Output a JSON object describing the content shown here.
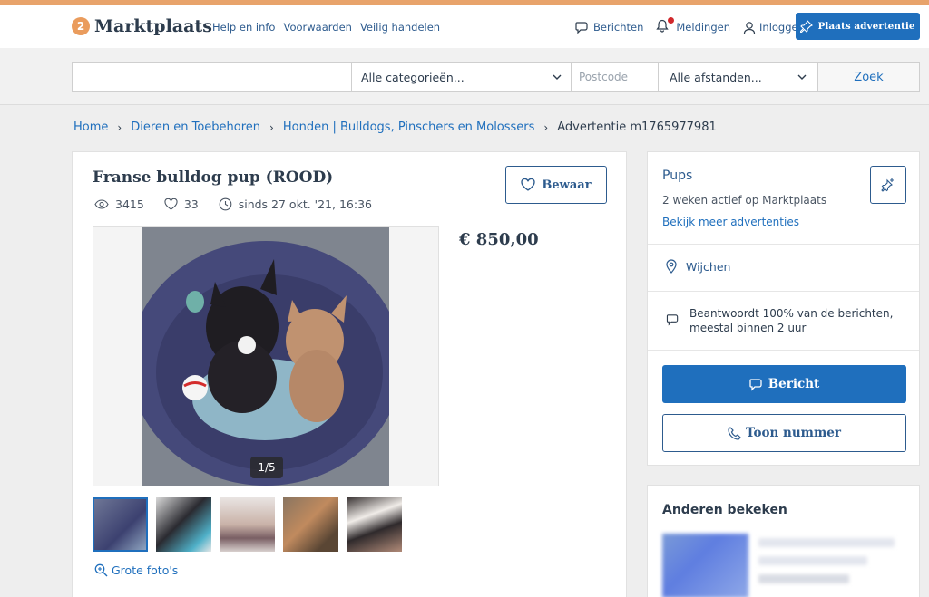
{
  "header": {
    "logo_badge": "2",
    "logo_text": "Marktplaats",
    "links": [
      "Help en info",
      "Voorwaarden",
      "Veilig handelen"
    ],
    "messages": "Berichten",
    "notifications": "Meldingen",
    "login": "Inloggen",
    "place_ad": "Plaats advertentie"
  },
  "search": {
    "query": "",
    "category": "Alle categorieën...",
    "postcode_placeholder": "Postcode",
    "distance": "Alle afstanden...",
    "button": "Zoek"
  },
  "breadcrumb": [
    "Home",
    "Dieren en Toebehoren",
    "Honden | Bulldogs, Pinschers en Molossers",
    "Advertentie m1765977981"
  ],
  "listing": {
    "title": "Franse bulldog pup (ROOD)",
    "views": "3415",
    "favorites": "33",
    "since": "sinds 27 okt. '21, 16:36",
    "save": "Bewaar",
    "price": "€ 850,00",
    "photo_counter": "1/5",
    "photo_count": 5,
    "large_photos": "Grote foto's"
  },
  "seller": {
    "name": "Pups",
    "active": "2 weken actief op Marktplaats",
    "more_ads": "Bekijk meer advertenties",
    "location": "Wijchen",
    "response_line1": "Beantwoordt 100% van de berichten,",
    "response_line2": "meestal binnen 2 uur",
    "message_button": "Bericht",
    "phone_button": "Toon nummer"
  },
  "others": {
    "title": "Anderen bekeken"
  },
  "colors": {
    "accent": "#1f6fbd",
    "brand_orange": "#ea9c5d",
    "text_dark": "#2d3c4d"
  }
}
